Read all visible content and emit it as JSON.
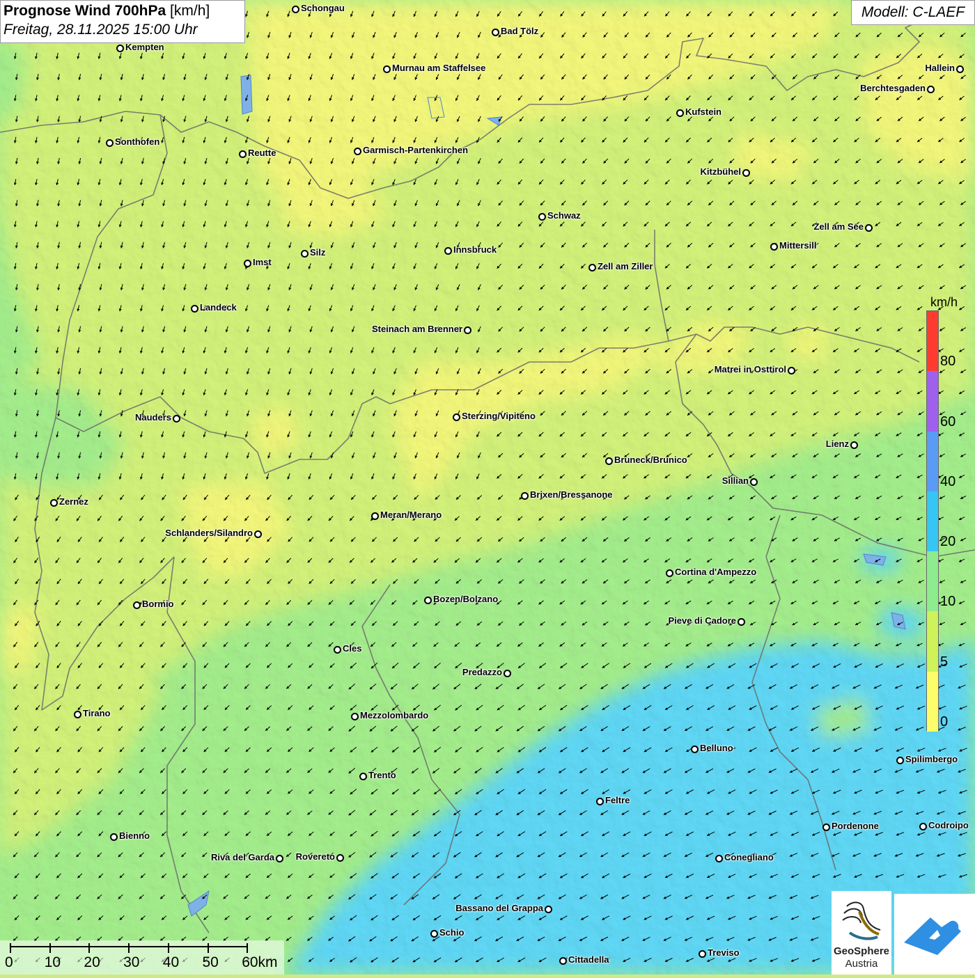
{
  "header": {
    "title_bold": "Prognose Wind 700hPa",
    "title_unit": " [km/h]",
    "datetime": "Freitag, 28.11.2025 15:00 Uhr"
  },
  "model_label": "Modell: C-LAEF",
  "legend": {
    "unit": "km/h",
    "ticks": [
      "80",
      "60",
      "40",
      "20",
      "10",
      "5",
      "0"
    ],
    "colors": [
      "#ff3b30",
      "#a060ee",
      "#5a9cf5",
      "#35c6f3",
      "#8eec8e",
      "#cdf25a",
      "#fdfd6a"
    ]
  },
  "scale": {
    "labels": [
      "0",
      "10",
      "20",
      "30",
      "40",
      "50",
      "60km"
    ]
  },
  "logo": {
    "line1": "GeoSphere",
    "line2": "Austria",
    "name": "geosphere-logo"
  },
  "cities": [
    {
      "name": "Schongau",
      "side": "r"
    },
    {
      "name": "Bad Tölz",
      "side": "r"
    },
    {
      "name": "Kempten",
      "side": "r"
    },
    {
      "name": "Murnau am Staffelsee",
      "side": "r"
    },
    {
      "name": "Hallein",
      "side": "l"
    },
    {
      "name": "Berchtesgaden",
      "side": "l"
    },
    {
      "name": "Kufstein",
      "side": "r"
    },
    {
      "name": "Sonthofen",
      "side": "r"
    },
    {
      "name": "Reutte",
      "side": "r"
    },
    {
      "name": "Garmisch-Partenkirchen",
      "side": "r"
    },
    {
      "name": "Kitzbühel",
      "side": "l"
    },
    {
      "name": "Schwaz",
      "side": "r"
    },
    {
      "name": "Zell am See",
      "side": "l"
    },
    {
      "name": "Mittersill",
      "side": "r"
    },
    {
      "name": "Innsbruck",
      "side": "r"
    },
    {
      "name": "Silz",
      "side": "r"
    },
    {
      "name": "Imst",
      "side": "r"
    },
    {
      "name": "Zell am Ziller",
      "side": "r"
    },
    {
      "name": "Landeck",
      "side": "r"
    },
    {
      "name": "Steinach am Brenner",
      "side": "l"
    },
    {
      "name": "Matrei in Osttirol",
      "side": "l"
    },
    {
      "name": "Nauders",
      "side": "l"
    },
    {
      "name": "Sterzing/Vipiteno",
      "side": "r"
    },
    {
      "name": "Lienz",
      "side": "l"
    },
    {
      "name": "Bruneck/Brunico",
      "side": "r"
    },
    {
      "name": "Sillian",
      "side": "l"
    },
    {
      "name": "Zernez",
      "side": "r"
    },
    {
      "name": "Brixen/Bressanone",
      "side": "r"
    },
    {
      "name": "Meran/Merano",
      "side": "r"
    },
    {
      "name": "Schlanders/Silandro",
      "side": "l"
    },
    {
      "name": "Cortina d'Ampezzo",
      "side": "r"
    },
    {
      "name": "Bozen/Bolzano",
      "side": "r"
    },
    {
      "name": "Bormio",
      "side": "r"
    },
    {
      "name": "Pieve di Cadore",
      "side": "l"
    },
    {
      "name": "Cles",
      "side": "r"
    },
    {
      "name": "Predazzo",
      "side": "l"
    },
    {
      "name": "Tirano",
      "side": "r"
    },
    {
      "name": "Mezzolombardo",
      "side": "r"
    },
    {
      "name": "Belluno",
      "side": "r"
    },
    {
      "name": "Spilimbergo",
      "side": "r"
    },
    {
      "name": "Trento",
      "side": "r"
    },
    {
      "name": "Feltre",
      "side": "r"
    },
    {
      "name": "Pordenone",
      "side": "r"
    },
    {
      "name": "Codroipo",
      "side": "r"
    },
    {
      "name": "Bienno",
      "side": "r"
    },
    {
      "name": "Riva del Garda",
      "side": "l"
    },
    {
      "name": "Rovereto",
      "side": "l"
    },
    {
      "name": "Conegliano",
      "side": "r"
    },
    {
      "name": "Bassano del Grappa",
      "side": "l"
    },
    {
      "name": "Schio",
      "side": "r"
    },
    {
      "name": "Treviso",
      "side": "r"
    },
    {
      "name": "Cittadella",
      "side": "r"
    }
  ]
}
